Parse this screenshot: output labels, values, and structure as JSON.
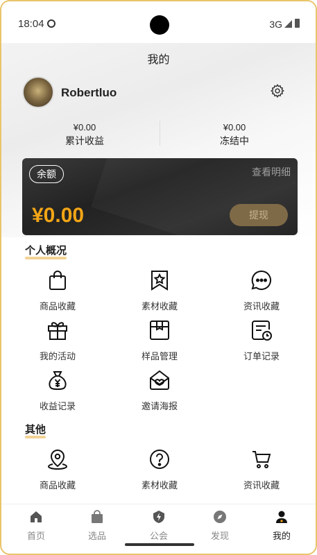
{
  "status": {
    "time": "18:04",
    "network": "3G"
  },
  "header": {
    "title": "我的"
  },
  "profile": {
    "username": "Robertluo"
  },
  "stats": [
    {
      "value": "¥0.00",
      "label": "累计收益"
    },
    {
      "value": "¥0.00",
      "label": "冻结中"
    }
  ],
  "balance": {
    "badge": "余额",
    "detail": "查看明细",
    "amount": "¥0.00",
    "withdraw": "提现"
  },
  "personal": {
    "title": "个人概况",
    "items": [
      {
        "label": "商品收藏",
        "icon": "shopping-bag-icon"
      },
      {
        "label": "素材收藏",
        "icon": "bookmark-star-icon"
      },
      {
        "label": "资讯收藏",
        "icon": "chat-bubble-icon"
      },
      {
        "label": "我的活动",
        "icon": "gift-icon"
      },
      {
        "label": "样品管理",
        "icon": "box-icon"
      },
      {
        "label": "订单记录",
        "icon": "order-clock-icon"
      },
      {
        "label": "收益记录",
        "icon": "money-bag-icon"
      },
      {
        "label": "邀请海报",
        "icon": "heart-envelope-icon"
      }
    ]
  },
  "other": {
    "title": "其他",
    "items": [
      {
        "label": "商品收藏",
        "icon": "location-pin-icon"
      },
      {
        "label": "素材收藏",
        "icon": "question-circle-icon"
      },
      {
        "label": "资讯收藏",
        "icon": "shopping-cart-icon"
      }
    ]
  },
  "tabs": [
    {
      "label": "首页",
      "icon": "home-icon"
    },
    {
      "label": "选品",
      "icon": "bag-icon"
    },
    {
      "label": "公会",
      "icon": "lightning-shield-icon"
    },
    {
      "label": "发现",
      "icon": "compass-icon"
    },
    {
      "label": "我的",
      "icon": "user-icon",
      "active": true
    }
  ],
  "colors": {
    "accent": "#f2a516",
    "card": "#222222",
    "tab_active": "#222222",
    "tab_inactive": "#888888"
  }
}
